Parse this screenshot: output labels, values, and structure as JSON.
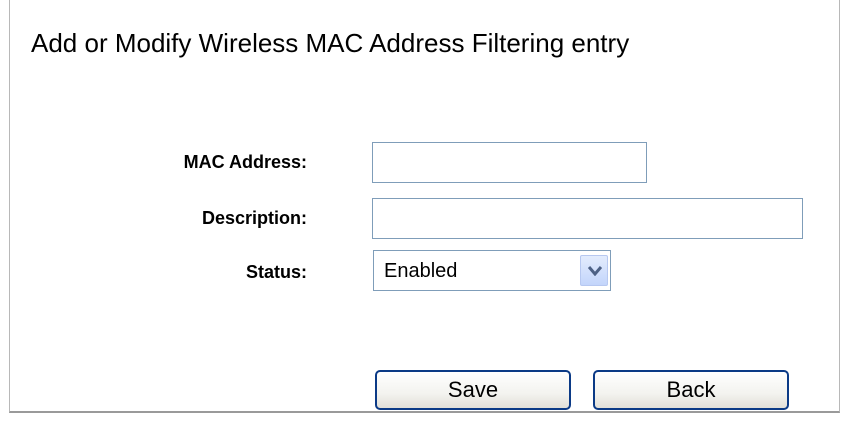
{
  "page": {
    "title": "Add or Modify Wireless MAC Address Filtering entry"
  },
  "form": {
    "mac_address": {
      "label": "MAC Address:",
      "value": ""
    },
    "description": {
      "label": "Description:",
      "value": ""
    },
    "status": {
      "label": "Status:",
      "selected": "Enabled"
    }
  },
  "buttons": {
    "save": "Save",
    "back": "Back"
  },
  "icons": {
    "select_arrow": "chevron-down-icon"
  },
  "colors": {
    "field_border": "#7f9db9",
    "button_border": "#0b3a86",
    "arrow_color": "#4d6185"
  }
}
